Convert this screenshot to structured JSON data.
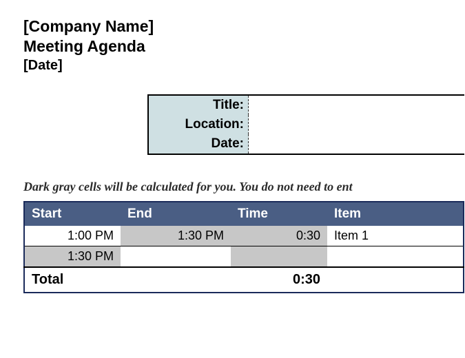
{
  "header": {
    "company": "[Company Name]",
    "title": "Meeting Agenda",
    "date": "[Date]"
  },
  "info": {
    "title_label": "Title:",
    "location_label": "Location:",
    "date_label": "Date:",
    "title_value": "",
    "location_value": "",
    "date_value": ""
  },
  "hint": "Dark gray cells will be calculated for you. You do not need to ent",
  "table": {
    "columns": {
      "start": "Start",
      "end": "End",
      "time": "Time",
      "item": "Item"
    },
    "rows": [
      {
        "start": "1:00 PM",
        "end": "1:30 PM",
        "time": "0:30",
        "item": "Item 1"
      },
      {
        "start": "1:30 PM",
        "end": "",
        "time": "",
        "item": ""
      }
    ],
    "total_label": "Total",
    "total_time": "0:30"
  }
}
